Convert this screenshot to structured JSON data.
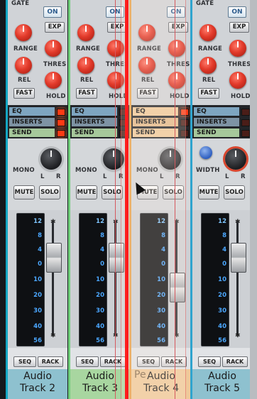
{
  "strips": [
    {
      "id": "track2",
      "accent": "#14a7c4",
      "name_line1": "Audio",
      "name_line2": "Track 2",
      "fader_pos": 0.33
    },
    {
      "id": "track3",
      "accent": "#6fce7a",
      "name_line1": "Audio",
      "name_line2": "Track 3",
      "fader_pos": 0.33
    },
    {
      "id": "track4",
      "accent": "#e5a44e",
      "name_line1": "Audio",
      "name_line2": "Track 4",
      "fader_pos": 0.55
    },
    {
      "id": "track5",
      "accent": "#2fa4ce",
      "name_line1": "Audio",
      "name_line2": "Track 5",
      "fader_pos": 0.33
    }
  ],
  "labels": {
    "gate": "GATE",
    "on": "ON",
    "exp": "EXP",
    "range": "RANGE",
    "thres": "THRES",
    "rel": "REL",
    "hold": "HOLD",
    "fast": "FAST",
    "eq": "EQ",
    "inserts": "INSERTS",
    "send": "SEND",
    "mono": "MONO",
    "width": "WIDTH",
    "l": "L",
    "r": "R",
    "mute": "MUTE",
    "solo": "SOLO",
    "seq": "SEQ",
    "rack": "RACK"
  },
  "meter_ticks": [
    "12",
    "8",
    "4",
    "0",
    "10",
    "20",
    "30",
    "40",
    "56"
  ],
  "ghost_name": "Pe",
  "colors": {
    "insert_indicator": "#ff1c1c",
    "led_on": "#ff3b14"
  }
}
